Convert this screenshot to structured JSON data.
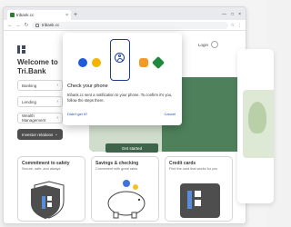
{
  "browser": {
    "tab_title": "tribank.cc",
    "tab_close": "×",
    "new_tab": "+",
    "window_controls": [
      "—",
      "□",
      "×"
    ],
    "nav": [
      "←",
      "→",
      "↻"
    ],
    "url": "tribank.cc",
    "toolbar_icons": [
      "☆",
      "⋮"
    ]
  },
  "header": {
    "login_label": "Login",
    "chevron": "⌄"
  },
  "welcome": {
    "line1": "Welcome to",
    "line2": "Tri.Bank"
  },
  "menu": {
    "items": [
      {
        "label": "Banking",
        "chevron": "›"
      },
      {
        "label": "Lending",
        "chevron": "›"
      },
      {
        "label": "Wealth Management",
        "chevron": "›"
      },
      {
        "label": "Investor relations",
        "chevron": "⌄"
      }
    ]
  },
  "hero": {
    "cta_label": "Get started"
  },
  "cards": [
    {
      "title": "Commitment to safety",
      "subtitle": "Secure, safe, and always"
    },
    {
      "title": "Savings & checking",
      "subtitle": "Convenient with great rates"
    },
    {
      "title": "Credit cards",
      "subtitle": "Find the card that works for you"
    }
  ],
  "modal": {
    "title": "Check your phone",
    "text": "tribank.cc sent a notification to your phone. To confirm it's you, follow the steps there.",
    "link_label": "Didn't get it?",
    "cancel_label": "Cancel"
  },
  "colors": {
    "accent_blue": "#1b4dbf",
    "brand_green": "#2f6b3f",
    "dot_blue": "#1e5bd8",
    "dot_yellow": "#f5b400",
    "dot_orange": "#f29a25",
    "dot_green": "#1f8a3c"
  }
}
